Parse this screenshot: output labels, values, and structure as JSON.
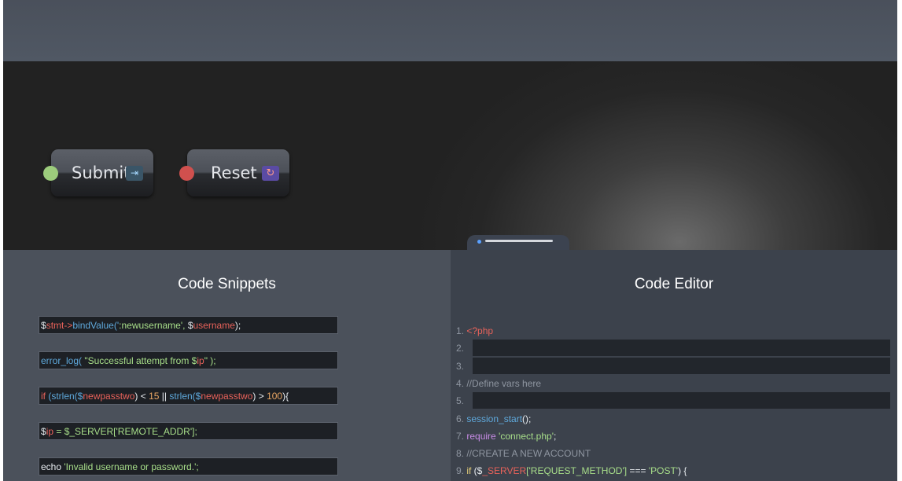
{
  "buttons": {
    "submit": {
      "label": "Submit",
      "icon": "enter-arrow-icon",
      "glyph": "⇥",
      "indicator_color": "#9ccc7c"
    },
    "reset": {
      "label": "Reset",
      "icon": "refresh-icon",
      "glyph": "↻",
      "indicator_color": "#d0504e"
    }
  },
  "snippets_panel": {
    "title": "Code Snippets",
    "snippets": [
      [
        [
          "$",
          "c-white"
        ],
        [
          "stmt->",
          "c-red"
        ],
        [
          "bindValue('",
          "c-blue"
        ],
        [
          ":newusername', ",
          "c-green"
        ],
        [
          "$",
          "c-white"
        ],
        [
          "username",
          "c-red"
        ],
        [
          ");",
          "c-white"
        ]
      ],
      [
        [
          "error_log( ",
          "c-blue"
        ],
        [
          "\"Successful attempt from $",
          "c-green"
        ],
        [
          "ip",
          "c-red"
        ],
        [
          "\" );",
          "c-green"
        ]
      ],
      [
        [
          "if",
          "c-red"
        ],
        [
          " (strlen($",
          "c-blue"
        ],
        [
          "newpasstwo",
          "c-red"
        ],
        [
          ") < ",
          "c-white"
        ],
        [
          "15",
          "c-orange"
        ],
        [
          " || ",
          "c-white"
        ],
        [
          "strlen($",
          "c-blue"
        ],
        [
          "newpasstwo",
          "c-red"
        ],
        [
          ") > ",
          "c-white"
        ],
        [
          "100",
          "c-orange"
        ],
        [
          "){",
          "c-white"
        ]
      ],
      [
        [
          "$",
          "c-white"
        ],
        [
          "ip",
          "c-red"
        ],
        [
          " = $_SERVER['REMOTE_ADDR'];",
          "c-green"
        ]
      ],
      [
        [
          "echo",
          "c-white"
        ],
        [
          " 'Invalid username or password.';",
          "c-green"
        ]
      ]
    ]
  },
  "editor_panel": {
    "title": "Code Editor",
    "lines": [
      {
        "num": "1.",
        "parts": [
          [
            "<?php",
            "c-red"
          ]
        ],
        "highlight": false
      },
      {
        "num": "2.",
        "parts": [],
        "highlight": true
      },
      {
        "num": "3.",
        "parts": [],
        "highlight": true
      },
      {
        "num": "4.",
        "parts": [
          [
            "//Define vars here",
            "c-gray"
          ]
        ],
        "highlight": false
      },
      {
        "num": "5.",
        "parts": [],
        "highlight": true
      },
      {
        "num": "6.",
        "parts": [
          [
            "session_start",
            "c-blue"
          ],
          [
            "();",
            "c-white"
          ]
        ],
        "highlight": false
      },
      {
        "num": "7.",
        "parts": [
          [
            "require ",
            "c-purple"
          ],
          [
            "'connect.php'",
            "c-green"
          ],
          [
            ";",
            "c-white"
          ]
        ],
        "highlight": false
      },
      {
        "num": "8.",
        "parts": [
          [
            "//CREATE A NEW ACCOUNT",
            "c-gray"
          ]
        ],
        "highlight": false
      },
      {
        "num": "9.",
        "parts": [
          [
            "if",
            "c-yellow"
          ],
          [
            " ($",
            "c-white"
          ],
          [
            "_SERVER",
            "c-red"
          ],
          [
            "['REQUEST_METHOD']",
            "c-green"
          ],
          [
            " === ",
            "c-white"
          ],
          [
            "'POST'",
            "c-green"
          ],
          [
            ") {",
            "c-white"
          ]
        ],
        "highlight": false
      }
    ]
  }
}
